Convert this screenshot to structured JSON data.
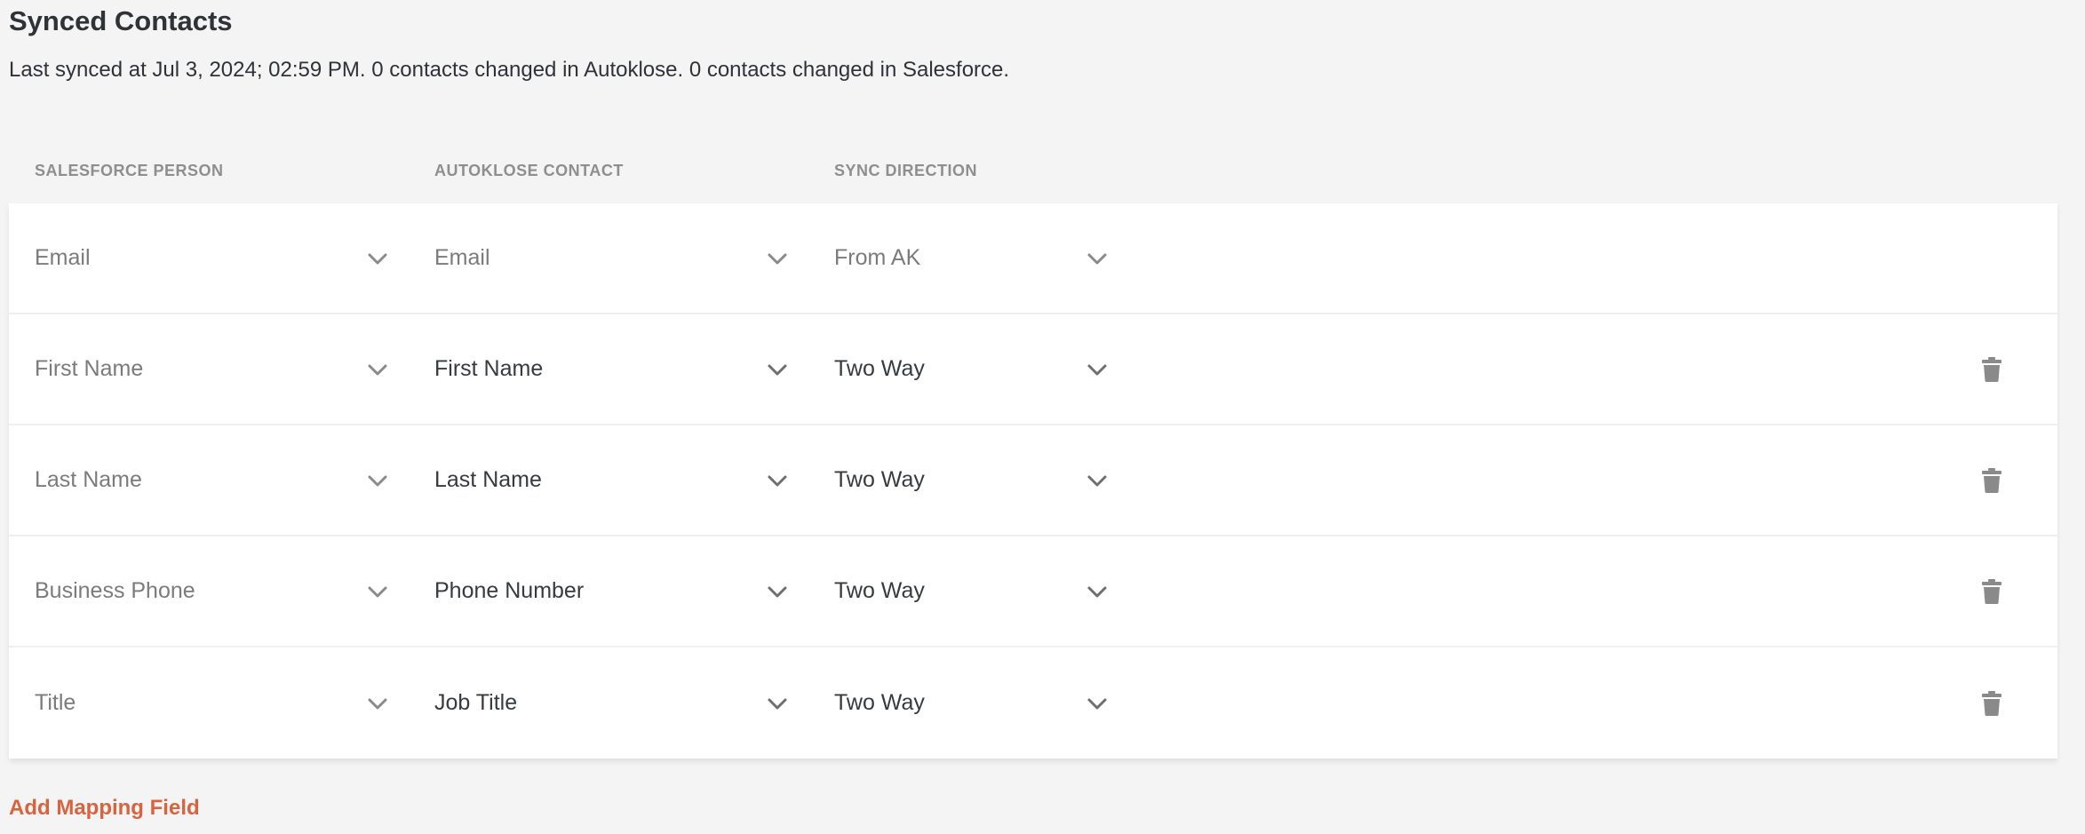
{
  "header": {
    "title": "Synced Contacts",
    "sync_status": "Last synced at Jul 3, 2024; 02:59 PM. 0 contacts changed in Autoklose. 0 contacts changed in Salesforce."
  },
  "columns": {
    "salesforce": "SALESFORCE PERSON",
    "autoklose": "AUTOKLOSE CONTACT",
    "direction": "SYNC DIRECTION"
  },
  "rows": [
    {
      "salesforce": "Email",
      "autoklose": "Email",
      "direction": "From AK",
      "locked": true
    },
    {
      "salesforce": "First Name",
      "autoklose": "First Name",
      "direction": "Two Way",
      "locked": false
    },
    {
      "salesforce": "Last Name",
      "autoklose": "Last Name",
      "direction": "Two Way",
      "locked": false
    },
    {
      "salesforce": "Business Phone",
      "autoklose": "Phone Number",
      "direction": "Two Way",
      "locked": false
    },
    {
      "salesforce": "Title",
      "autoklose": "Job Title",
      "direction": "Two Way",
      "locked": false
    }
  ],
  "actions": {
    "add_mapping": "Add Mapping Field"
  },
  "colors": {
    "accent": "#d8633d",
    "background": "#f4f4f4",
    "muted_text": "#7b7b7b",
    "icon": "#8a8a8a"
  },
  "icons": {
    "dropdown": "chevron-down-icon",
    "delete": "trash-icon"
  }
}
